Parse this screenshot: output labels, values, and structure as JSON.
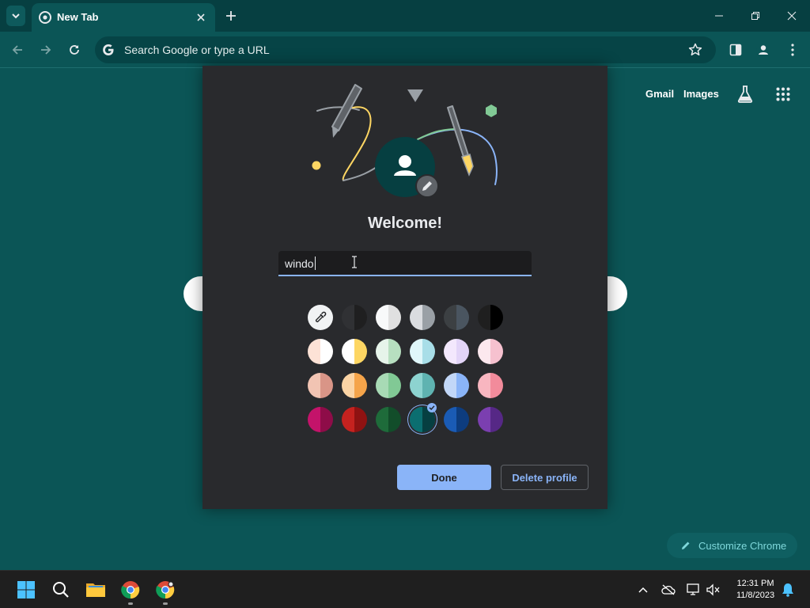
{
  "browser": {
    "tab": {
      "title": "New Tab"
    },
    "omnibox": {
      "placeholder": "Search Google or type a URL"
    }
  },
  "ntp": {
    "links": {
      "gmail": "Gmail",
      "images": "Images"
    },
    "customize_label": "Customize Chrome"
  },
  "dialog": {
    "heading": "Welcome!",
    "name_field": {
      "value": "windo"
    },
    "color_picker": {
      "selected": "teal",
      "swatches": [
        [
          "custom-color-picker",
          "#303134/#1f1f20",
          "#f8f9fa/#e0e0e0",
          "#dadce0/#9aa0a6",
          "#3c4043/#4a5560",
          "#1f1f1f/#000000"
        ],
        [
          "#fde2d6/#ffffff",
          "#ffffff/#fdd663",
          "#e6f4ea/#b7dfc0",
          "#e0f7fa/#a8dee8",
          "#f3e8fd/#e3d5f8",
          "#fce8ee/#f6c1cf"
        ],
        [
          "#f2c4b3/#d99587",
          "#fbd4a5/#f5a44a",
          "#a8dab5/#81c995",
          "#8dd3d0/#5fb3b1",
          "#c2d7f8/#8ab4f8",
          "#f8b6c0/#f28b9b"
        ],
        [
          "#c4136a/#8e0c48",
          "#c5221f/#8f1212",
          "#1e6b3a/#124d2a",
          "#0b6e70/#063f41",
          "#1a5bb5/#0d3c7e",
          "#7b3fb0/#562886"
        ]
      ]
    },
    "buttons": {
      "done": "Done",
      "delete": "Delete profile"
    }
  },
  "taskbar": {
    "clock": {
      "time": "12:31 PM",
      "date": "11/8/2023"
    }
  },
  "colors": {
    "accent": "#8ab4f8",
    "theme": "#0b5556",
    "dialog_bg": "#292a2d"
  }
}
